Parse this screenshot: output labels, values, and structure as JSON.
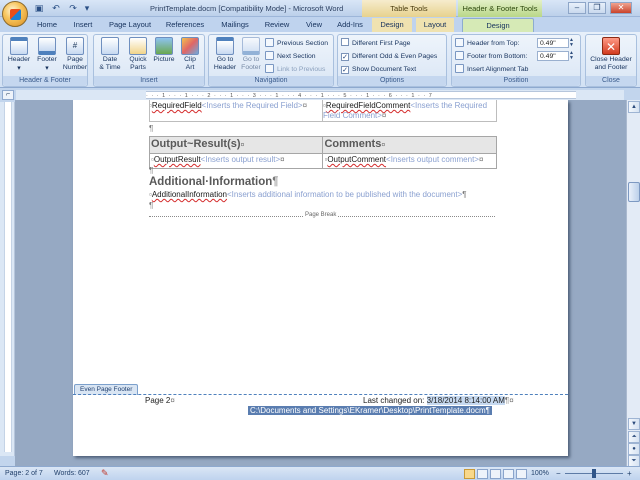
{
  "window": {
    "title": "PrintTemplate.docm [Compatibility Mode] - Microsoft Word",
    "contextual_tab_groups": [
      "Table Tools",
      "Header & Footer Tools"
    ],
    "controls": [
      "‒",
      "❐",
      "✕"
    ]
  },
  "quick_access": {
    "save_icon": "save-icon",
    "undo_icon": "undo-icon",
    "redo_icon": "redo-icon"
  },
  "tabs": [
    "Home",
    "Insert",
    "Page Layout",
    "References",
    "Mailings",
    "Review",
    "View",
    "Add-Ins",
    "Design",
    "Layout",
    "Design"
  ],
  "active_tab_index": 10,
  "ribbon": {
    "header_footer": {
      "label": "Header & Footer",
      "header": "Header",
      "footer": "Footer",
      "page_number": "Page\nNumber"
    },
    "insert": {
      "label": "Insert",
      "date_time": "Date\n& Time",
      "quick_parts": "Quick\nParts",
      "picture": "Picture",
      "clip_art": "Clip\nArt"
    },
    "navigation": {
      "label": "Navigation",
      "go_to_header": "Go to\nHeader",
      "go_to_footer": "Go to\nFooter",
      "previous_section": "Previous Section",
      "next_section": "Next Section",
      "link_to_previous": "Link to Previous"
    },
    "options": {
      "label": "Options",
      "different_first_page": "Different First Page",
      "different_odd_even": "Different Odd & Even Pages",
      "show_document_text": "Show Document Text",
      "different_first_page_checked": false,
      "different_odd_even_checked": true,
      "show_document_text_checked": true
    },
    "position": {
      "label": "Position",
      "header_from_top_label": "Header from Top:",
      "header_from_top_value": "0.49\"",
      "footer_from_bottom_label": "Footer from Bottom:",
      "footer_from_bottom_value": "0.49\"",
      "insert_alignment_tab": "Insert Alignment Tab"
    },
    "close": {
      "label": "Close",
      "close_header_footer": "Close Header\nand Footer"
    }
  },
  "ruler": {
    "marks": "· · · 1 · · · 1 · · · 2 · · · 1 · · · 3 · · · 1 · · · 4 · · · 1 · · · 5 · · · 1 · · · 6 · · · 1 · · 7"
  },
  "document": {
    "row1_left_code": "RequiredField",
    "row1_left_hint": "<Inserts the Required Field>",
    "row1_right_code": "RequiredFieldComment",
    "row1_right_hint_a": "<Inserts the Required",
    "row1_right_hint_b": "Field Comment>",
    "heading_output_result": "Output~Result(s)",
    "heading_comments": "Comments",
    "output_result_code": "OutputResult",
    "output_result_hint": "<Inserts output result>",
    "output_comment_code": "OutputComment",
    "output_comment_hint": "<Inserts output comment>",
    "additional_info_heading": "Additional·Information",
    "additional_info_code": "AdditionalInformation",
    "additional_info_hint": "<Inserts additional information to be published with the document>",
    "page_break_label": "Page Break",
    "pilcrow": "¶",
    "cell_mark": "¤"
  },
  "footer": {
    "tag": "Even Page Footer",
    "page_text": "Page 2",
    "last_changed_label": "Last changed on:",
    "last_changed_value": "3/18/2014 8:14:00 AM",
    "path": "C:\\Documents and Settings\\EKramer\\Desktop\\PrintTemplate.docm"
  },
  "statusbar": {
    "page": "Page: 2 of 7",
    "words": "Words: 607",
    "zoom": "100%"
  },
  "colors": {
    "title_bar": "#d9e6f7",
    "table_tools_tab": "#efe2b0",
    "header_footer_tools_tab": "#d6eab6",
    "field_hint": "#8aa0d0",
    "footer_path_highlight": "#5a7db0"
  }
}
